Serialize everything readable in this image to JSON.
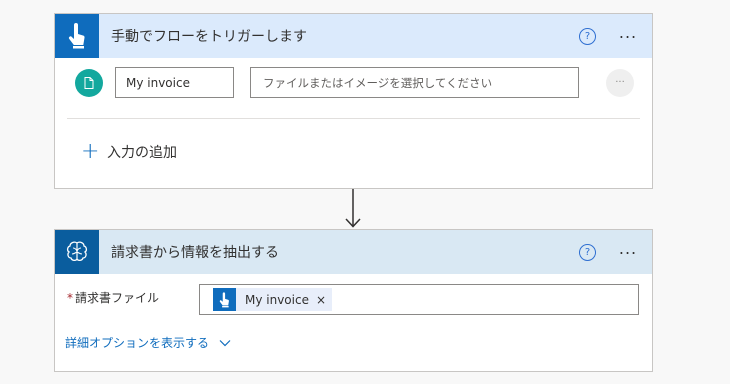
{
  "trigger": {
    "title": "手動でフローをトリガーします",
    "help": "?",
    "more": "...",
    "input": {
      "name_value": "My invoice",
      "value_placeholder": "ファイルまたはイメージを選択してください",
      "more": "..."
    },
    "add_input_label": "入力の追加",
    "icon": "touch-hand-icon"
  },
  "action": {
    "title": "請求書から情報を抽出する",
    "help": "?",
    "more": "...",
    "icon": "ai-brain-icon",
    "field": {
      "required_mark": "*",
      "label": "請求書ファイル",
      "token_label": "My invoice",
      "token_remove": "×",
      "token_icon": "touch-hand-icon"
    },
    "advanced_link": "詳細オプションを表示する"
  },
  "colors": {
    "trigger_header_bg": "#dbeafc",
    "action_header_bg": "#d9e8f3",
    "accent": "#0f6cbd",
    "file_icon": "#13a89e",
    "required": "#a4262c"
  }
}
